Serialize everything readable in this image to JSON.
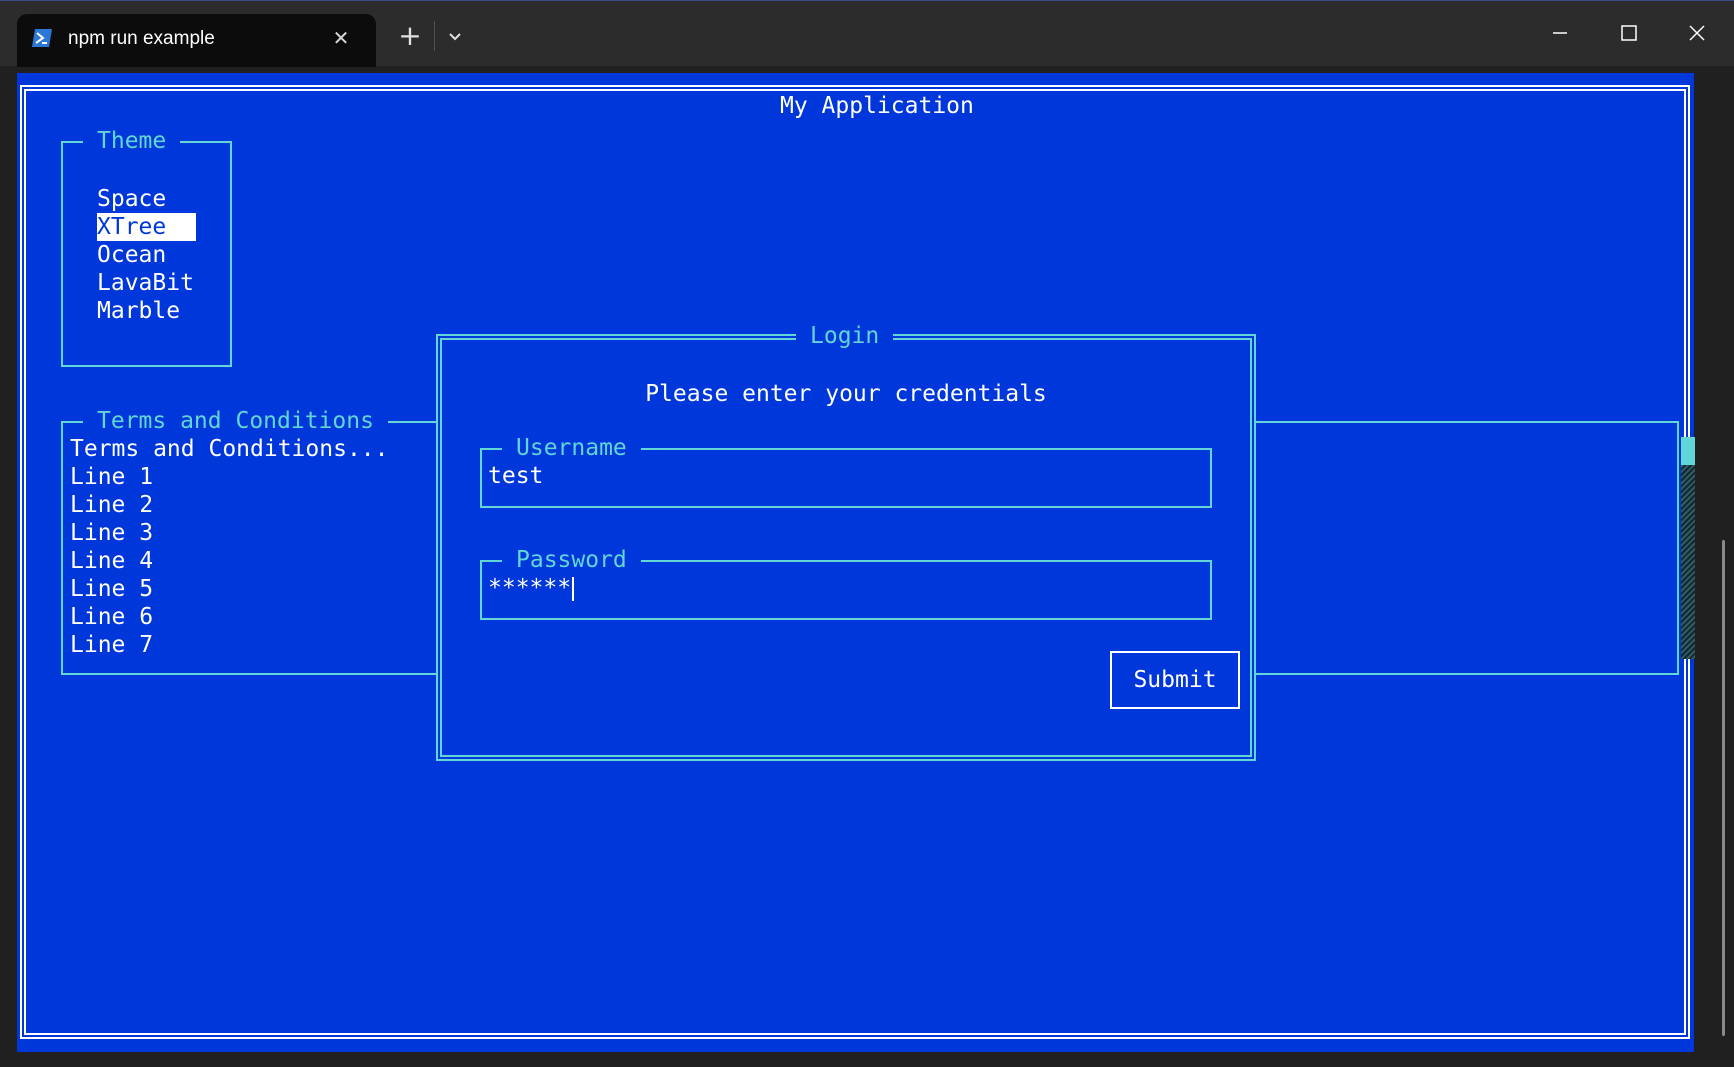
{
  "window": {
    "tab_title": "npm run example",
    "tab_icon": "powershell-icon",
    "colors": {
      "terminal_bg": "#0037da",
      "accent": "#61d6d6",
      "text": "#ffffff",
      "titlebar": "#2c2c2c"
    }
  },
  "app": {
    "title": "My Application"
  },
  "theme": {
    "title": "Theme",
    "items": [
      "Space",
      "XTree",
      "Ocean",
      "LavaBit",
      "Marble"
    ],
    "selected": "XTree"
  },
  "terms": {
    "title": "Terms and Conditions",
    "lines": [
      "Terms and Conditions...",
      "Line 1",
      "Line 2",
      "Line 3",
      "Line 4",
      "Line 5",
      "Line 6",
      "Line 7"
    ]
  },
  "login": {
    "title": "Login",
    "message": "Please enter your credentials",
    "username": {
      "label": "Username",
      "value": "test"
    },
    "password": {
      "label": "Password",
      "value": "******"
    },
    "submit_label": "Submit"
  }
}
